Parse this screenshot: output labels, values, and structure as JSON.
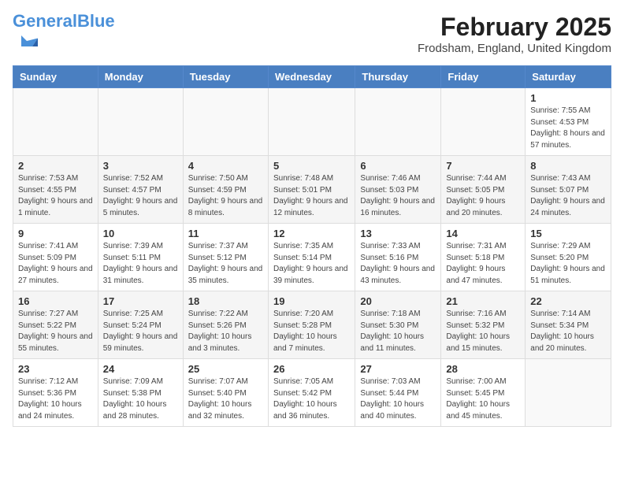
{
  "logo": {
    "text_general": "General",
    "text_blue": "Blue"
  },
  "header": {
    "month": "February 2025",
    "location": "Frodsham, England, United Kingdom"
  },
  "days_of_week": [
    "Sunday",
    "Monday",
    "Tuesday",
    "Wednesday",
    "Thursday",
    "Friday",
    "Saturday"
  ],
  "weeks": [
    {
      "days": [
        {
          "num": "",
          "info": ""
        },
        {
          "num": "",
          "info": ""
        },
        {
          "num": "",
          "info": ""
        },
        {
          "num": "",
          "info": ""
        },
        {
          "num": "",
          "info": ""
        },
        {
          "num": "",
          "info": ""
        },
        {
          "num": "1",
          "info": "Sunrise: 7:55 AM\nSunset: 4:53 PM\nDaylight: 8 hours and 57 minutes."
        }
      ]
    },
    {
      "days": [
        {
          "num": "2",
          "info": "Sunrise: 7:53 AM\nSunset: 4:55 PM\nDaylight: 9 hours and 1 minute."
        },
        {
          "num": "3",
          "info": "Sunrise: 7:52 AM\nSunset: 4:57 PM\nDaylight: 9 hours and 5 minutes."
        },
        {
          "num": "4",
          "info": "Sunrise: 7:50 AM\nSunset: 4:59 PM\nDaylight: 9 hours and 8 minutes."
        },
        {
          "num": "5",
          "info": "Sunrise: 7:48 AM\nSunset: 5:01 PM\nDaylight: 9 hours and 12 minutes."
        },
        {
          "num": "6",
          "info": "Sunrise: 7:46 AM\nSunset: 5:03 PM\nDaylight: 9 hours and 16 minutes."
        },
        {
          "num": "7",
          "info": "Sunrise: 7:44 AM\nSunset: 5:05 PM\nDaylight: 9 hours and 20 minutes."
        },
        {
          "num": "8",
          "info": "Sunrise: 7:43 AM\nSunset: 5:07 PM\nDaylight: 9 hours and 24 minutes."
        }
      ]
    },
    {
      "days": [
        {
          "num": "9",
          "info": "Sunrise: 7:41 AM\nSunset: 5:09 PM\nDaylight: 9 hours and 27 minutes."
        },
        {
          "num": "10",
          "info": "Sunrise: 7:39 AM\nSunset: 5:11 PM\nDaylight: 9 hours and 31 minutes."
        },
        {
          "num": "11",
          "info": "Sunrise: 7:37 AM\nSunset: 5:12 PM\nDaylight: 9 hours and 35 minutes."
        },
        {
          "num": "12",
          "info": "Sunrise: 7:35 AM\nSunset: 5:14 PM\nDaylight: 9 hours and 39 minutes."
        },
        {
          "num": "13",
          "info": "Sunrise: 7:33 AM\nSunset: 5:16 PM\nDaylight: 9 hours and 43 minutes."
        },
        {
          "num": "14",
          "info": "Sunrise: 7:31 AM\nSunset: 5:18 PM\nDaylight: 9 hours and 47 minutes."
        },
        {
          "num": "15",
          "info": "Sunrise: 7:29 AM\nSunset: 5:20 PM\nDaylight: 9 hours and 51 minutes."
        }
      ]
    },
    {
      "days": [
        {
          "num": "16",
          "info": "Sunrise: 7:27 AM\nSunset: 5:22 PM\nDaylight: 9 hours and 55 minutes."
        },
        {
          "num": "17",
          "info": "Sunrise: 7:25 AM\nSunset: 5:24 PM\nDaylight: 9 hours and 59 minutes."
        },
        {
          "num": "18",
          "info": "Sunrise: 7:22 AM\nSunset: 5:26 PM\nDaylight: 10 hours and 3 minutes."
        },
        {
          "num": "19",
          "info": "Sunrise: 7:20 AM\nSunset: 5:28 PM\nDaylight: 10 hours and 7 minutes."
        },
        {
          "num": "20",
          "info": "Sunrise: 7:18 AM\nSunset: 5:30 PM\nDaylight: 10 hours and 11 minutes."
        },
        {
          "num": "21",
          "info": "Sunrise: 7:16 AM\nSunset: 5:32 PM\nDaylight: 10 hours and 15 minutes."
        },
        {
          "num": "22",
          "info": "Sunrise: 7:14 AM\nSunset: 5:34 PM\nDaylight: 10 hours and 20 minutes."
        }
      ]
    },
    {
      "days": [
        {
          "num": "23",
          "info": "Sunrise: 7:12 AM\nSunset: 5:36 PM\nDaylight: 10 hours and 24 minutes."
        },
        {
          "num": "24",
          "info": "Sunrise: 7:09 AM\nSunset: 5:38 PM\nDaylight: 10 hours and 28 minutes."
        },
        {
          "num": "25",
          "info": "Sunrise: 7:07 AM\nSunset: 5:40 PM\nDaylight: 10 hours and 32 minutes."
        },
        {
          "num": "26",
          "info": "Sunrise: 7:05 AM\nSunset: 5:42 PM\nDaylight: 10 hours and 36 minutes."
        },
        {
          "num": "27",
          "info": "Sunrise: 7:03 AM\nSunset: 5:44 PM\nDaylight: 10 hours and 40 minutes."
        },
        {
          "num": "28",
          "info": "Sunrise: 7:00 AM\nSunset: 5:45 PM\nDaylight: 10 hours and 45 minutes."
        },
        {
          "num": "",
          "info": ""
        }
      ]
    }
  ]
}
